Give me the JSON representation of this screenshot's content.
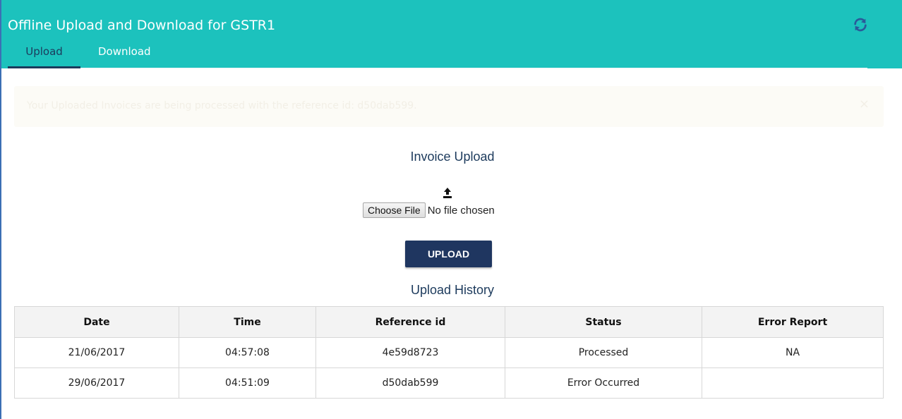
{
  "header": {
    "title": "Offline Upload and Download for GSTR1",
    "refresh_icon": "refresh-icon",
    "tabs": [
      {
        "label": "Upload",
        "active": true
      },
      {
        "label": "Download",
        "active": false
      }
    ]
  },
  "alert": {
    "message": "Your Uploaded Invoices are being processed with the reference id: d50dab599.",
    "close_label": "×"
  },
  "upload_section": {
    "title": "Invoice Upload",
    "icon": "upload-icon",
    "choose_file_label": "Choose File",
    "file_status": "No file chosen",
    "upload_button": "UPLOAD"
  },
  "history": {
    "title": "Upload History",
    "columns": [
      "Date",
      "Time",
      "Reference id",
      "Status",
      "Error Report"
    ],
    "rows": [
      {
        "date": "21/06/2017",
        "time": "04:57:08",
        "reference_id": "4e59d8723",
        "status": "Processed",
        "error_report": "NA"
      },
      {
        "date": "29/06/2017",
        "time": "04:51:09",
        "reference_id": "d50dab599",
        "status": "Error Occurred",
        "error_report": ""
      }
    ]
  },
  "colors": {
    "header_bg": "#1cc2bd",
    "navy": "#1f3660",
    "frame_border": "#3b6fb4"
  }
}
